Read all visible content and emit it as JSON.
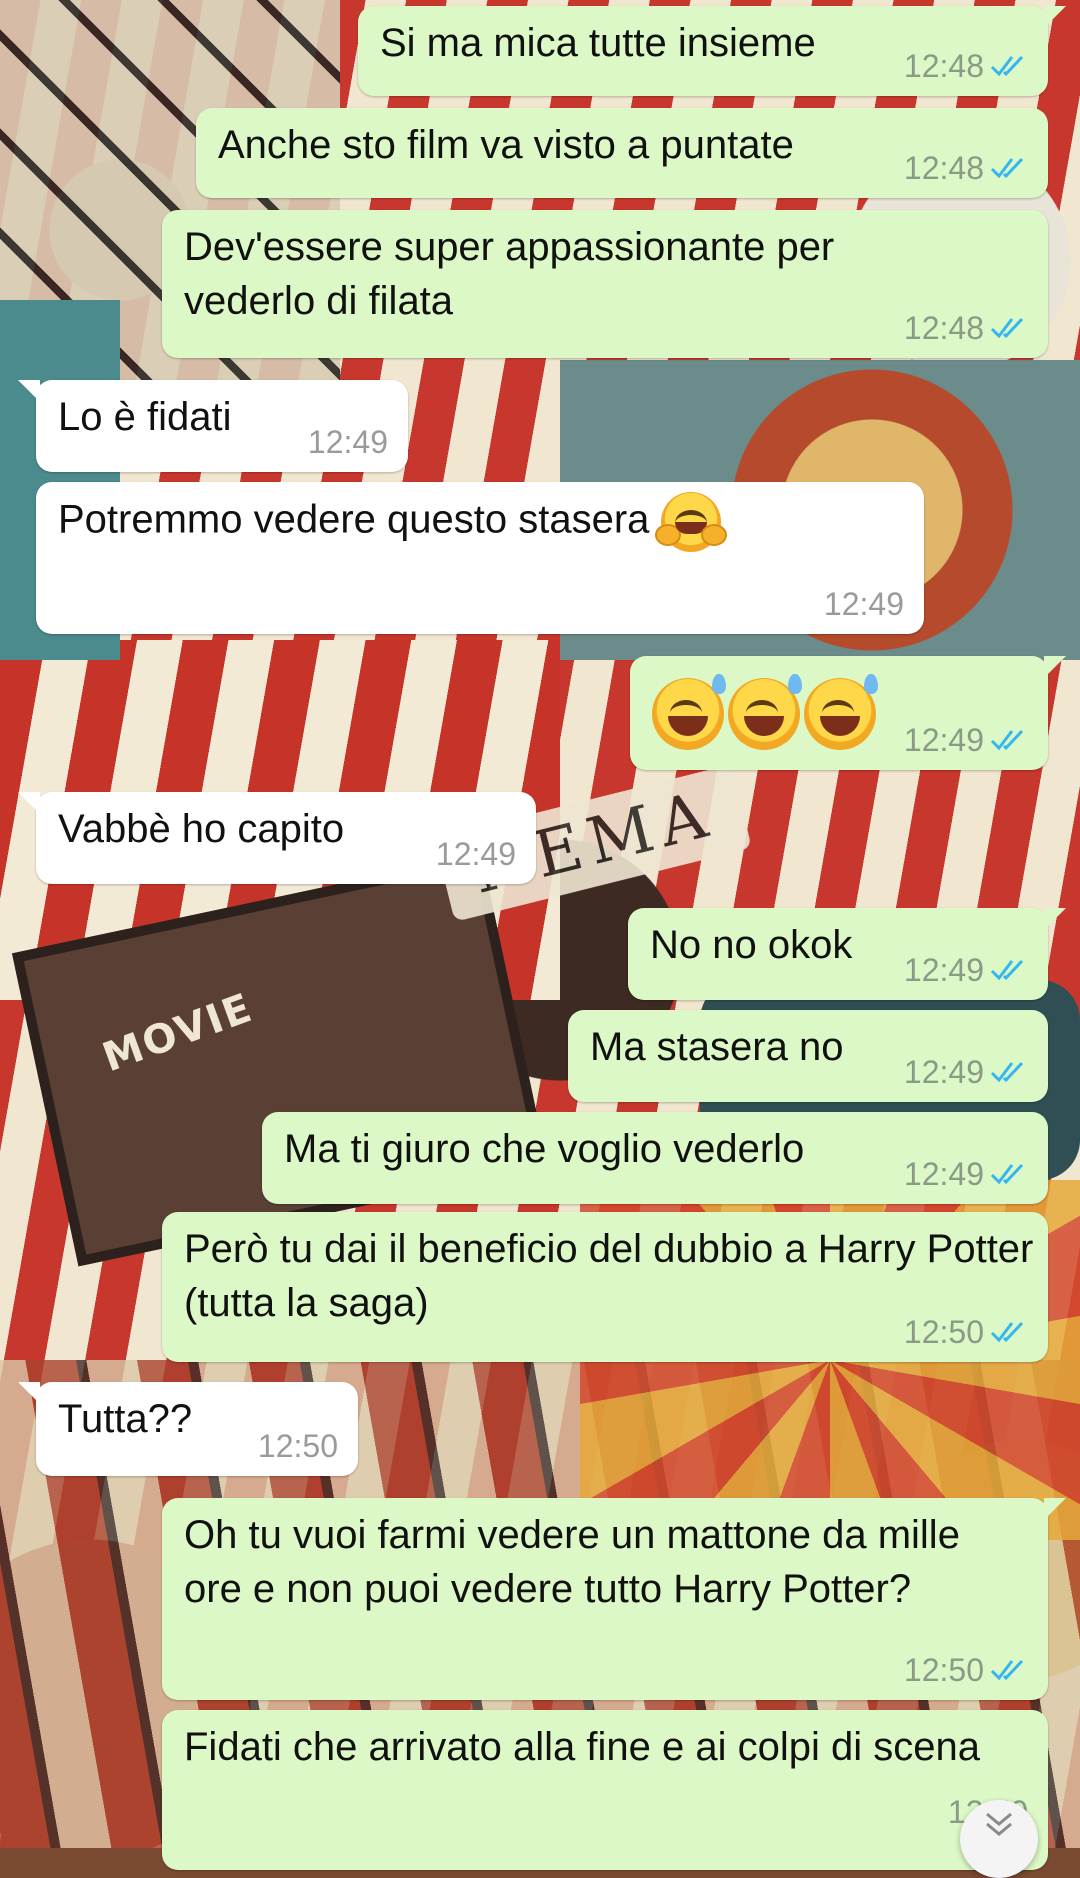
{
  "wallpaper": {
    "sign_cinema": "NEMA",
    "sign_movie": "MOVIE"
  },
  "colors": {
    "outgoing_bubble": "#dcf8c6",
    "incoming_bubble": "#ffffff",
    "read_ticks": "#34b7f1"
  },
  "messages": [
    {
      "direction": "out",
      "text": "Si ma mica tutte insieme",
      "time": "12:48",
      "status": "read"
    },
    {
      "direction": "out",
      "text": "Anche sto film va visto a puntate",
      "time": "12:48",
      "status": "read"
    },
    {
      "direction": "out",
      "text": "Dev'essere super appassionante per vederlo di filata",
      "time": "12:48",
      "status": "read"
    },
    {
      "direction": "in",
      "text": "Lo è fidati",
      "time": "12:49"
    },
    {
      "direction": "in",
      "text": "Potremmo vedere questo stasera",
      "emoji": "hugging-face",
      "time": "12:49"
    },
    {
      "direction": "out",
      "text": "",
      "emoji": "grinning-sweat x3",
      "time": "12:49",
      "status": "read"
    },
    {
      "direction": "in",
      "text": "Vabbè ho capito",
      "time": "12:49"
    },
    {
      "direction": "out",
      "text": "No no okok",
      "time": "12:49",
      "status": "read"
    },
    {
      "direction": "out",
      "text": "Ma stasera no",
      "time": "12:49",
      "status": "read"
    },
    {
      "direction": "out",
      "text": "Ma ti giuro che voglio vederlo",
      "time": "12:49",
      "status": "read"
    },
    {
      "direction": "out",
      "text": "Però tu dai il beneficio del dubbio a Harry Potter (tutta la saga)",
      "time": "12:50",
      "status": "read"
    },
    {
      "direction": "in",
      "text": "Tutta??",
      "time": "12:50"
    },
    {
      "direction": "out",
      "text": "Oh tu vuoi farmi vedere un mattone da mille ore e non puoi vedere tutto Harry Potter?",
      "time": "12:50",
      "status": "read"
    },
    {
      "direction": "out",
      "text": "Fidati che arrivato alla fine e ai colpi di scena",
      "time": "12:50",
      "status": "read"
    }
  ],
  "scroll_button": {
    "icon": "double-chevron-down-icon"
  }
}
